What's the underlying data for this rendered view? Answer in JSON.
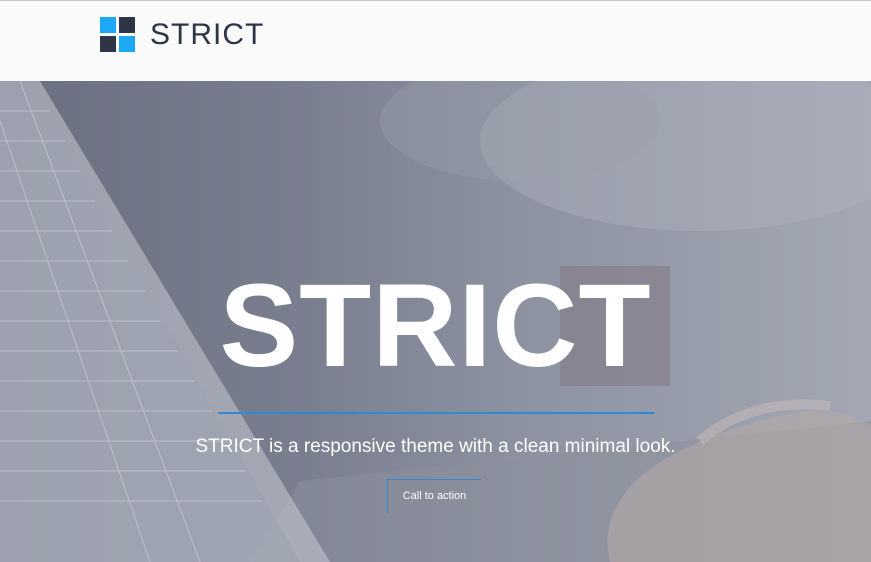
{
  "header": {
    "brand": "STRICT",
    "logo_colors": {
      "top_left": "#1ba9f5",
      "top_right": "#2e3547",
      "bottom_left": "#2e3547",
      "bottom_right": "#1ba9f5"
    }
  },
  "hero": {
    "title": "STRICT",
    "subtitle": "STRICT is a responsive theme with a clean minimal look.",
    "cta_label": "Call to action",
    "accent_color": "#2f8ad3"
  }
}
